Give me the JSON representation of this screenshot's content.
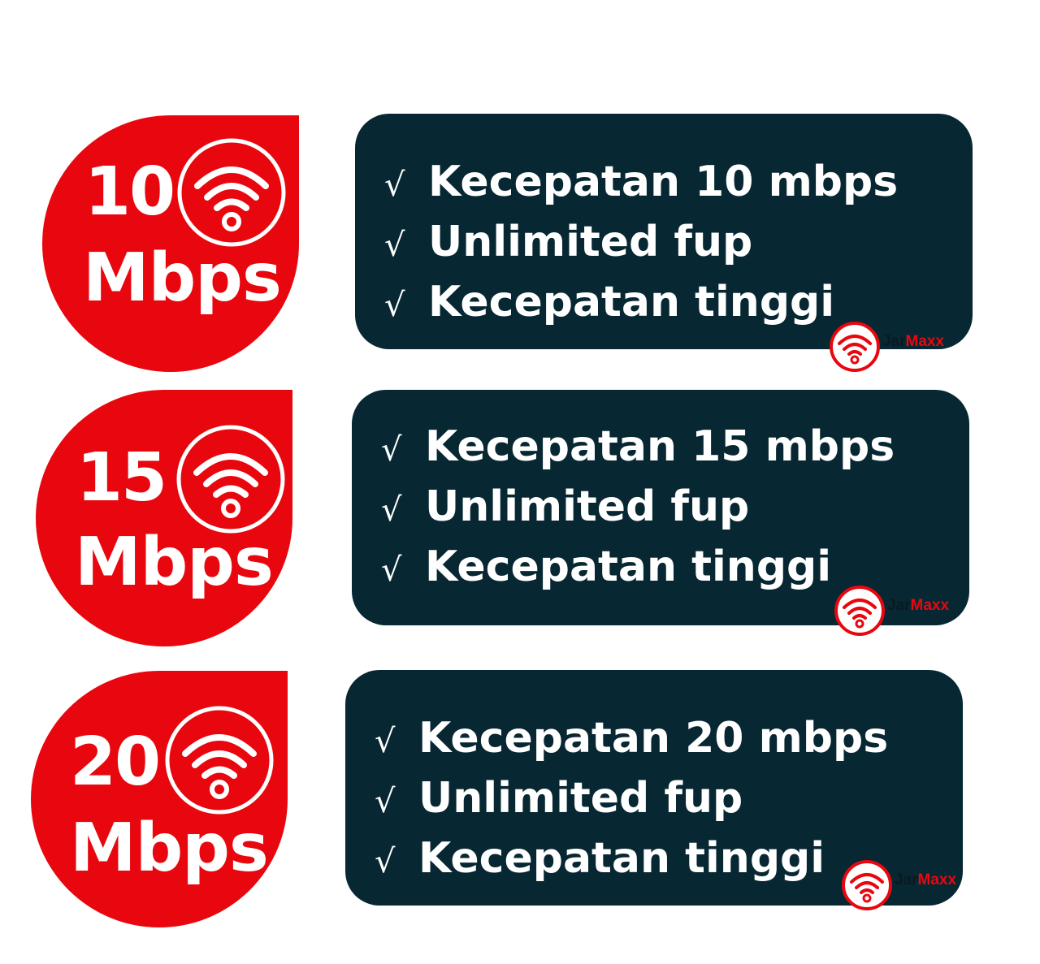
{
  "plans": [
    {
      "speed": "10",
      "unit": "Mbps",
      "features": [
        "Kecepatan 10 mbps",
        "Unlimited fup",
        "Kecepatan tinggi"
      ]
    },
    {
      "speed": "15",
      "unit": "Mbps",
      "features": [
        "Kecepatan 15 mbps",
        "Unlimited fup",
        "Kecepatan tinggi"
      ]
    },
    {
      "speed": "20",
      "unit": "Mbps",
      "features": [
        "Kecepatan 20 mbps",
        "Unlimited fup",
        "Kecepatan tinggi"
      ]
    }
  ],
  "check_mark": "√",
  "logo": {
    "part1": "Jar",
    "part2": "Maxx",
    "icon": "wifi-logo-icon"
  },
  "badge_icon": "wifi-icon",
  "colors": {
    "badge_red": "#e8070e",
    "card_dark": "#072732",
    "text_white": "#ffffff",
    "logo_dark": "#0a1a22"
  }
}
